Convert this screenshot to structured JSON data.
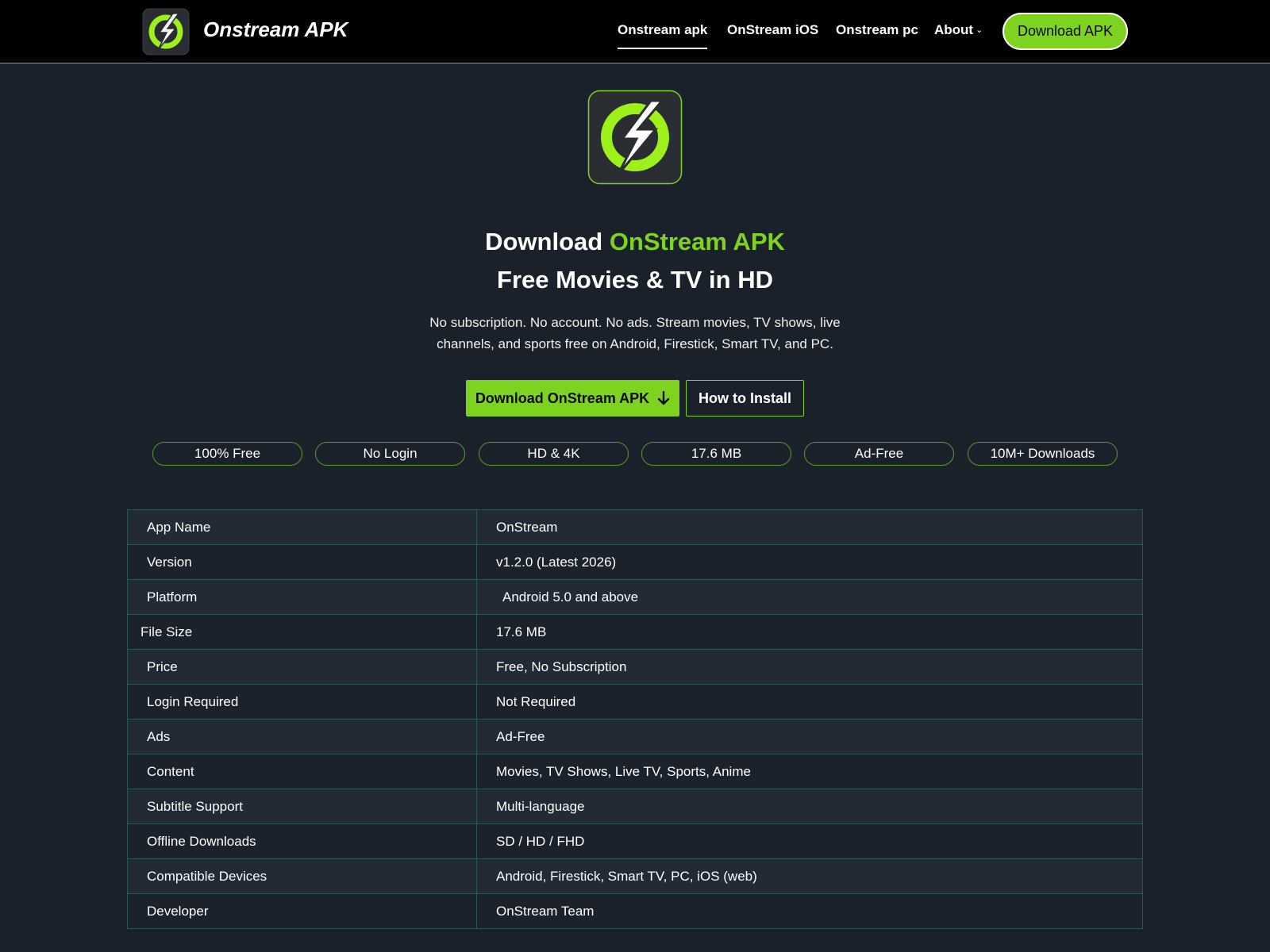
{
  "header": {
    "brand": "Onstream APK",
    "nav": [
      {
        "label": "Onstream apk",
        "active": true
      },
      {
        "label": "OnStream iOS",
        "active": false
      },
      {
        "label": "Onstream pc",
        "active": false
      },
      {
        "label": "About",
        "active": false
      }
    ],
    "about_chevron": "⌄",
    "download_button": "Download APK"
  },
  "hero": {
    "title_prefix": "Download ",
    "title_accent": "OnStream APK",
    "title_line2": "Free Movies & TV in HD",
    "description_line1": "No subscription. No account. No ads. Stream movies, TV shows, live",
    "description_line2": "channels, and sports free on Android, Firestick, Smart TV, and PC.",
    "primary_button": "Download OnStream APK",
    "primary_icon": "arrow-down-icon",
    "secondary_button": "How to Install"
  },
  "pills": [
    "100% Free",
    "No Login",
    "HD & 4K",
    "17.6 MB",
    "Ad-Free",
    "10M+ Downloads"
  ],
  "info_table": [
    {
      "key": "App Name",
      "value": "OnStream"
    },
    {
      "key": "Version",
      "value": "v1.2.0 (Latest 2026)"
    },
    {
      "key": "Platform",
      "value": "Android 5.0 and above"
    },
    {
      "key": "File Size",
      "value": "17.6 MB"
    },
    {
      "key": "Price",
      "value": "Free, No Subscription"
    },
    {
      "key": "Login Required",
      "value": "Not Required"
    },
    {
      "key": "Ads",
      "value": "Ad-Free"
    },
    {
      "key": "Content",
      "value": "Movies, TV Shows, Live TV, Sports, Anime"
    },
    {
      "key": "Subtitle Support",
      "value": "Multi-language"
    },
    {
      "key": "Offline Downloads",
      "value": "SD / HD / FHD"
    },
    {
      "key": "Compatible Devices",
      "value": "Android, Firestick, Smart TV, PC, iOS (web)"
    },
    {
      "key": "Developer",
      "value": "OnStream Team"
    }
  ],
  "colors": {
    "accent": "#7ed321",
    "background": "#1a212b",
    "header": "#000000",
    "table_border": "#2f5457"
  }
}
